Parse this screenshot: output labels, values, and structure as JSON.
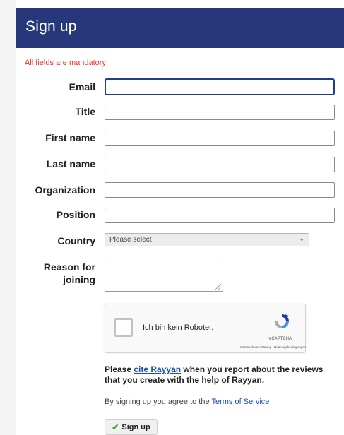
{
  "header": {
    "title": "Sign up"
  },
  "form": {
    "mandatory_note": "All fields are mandatory",
    "fields": {
      "email": {
        "label": "Email",
        "value": ""
      },
      "title": {
        "label": "Title",
        "value": ""
      },
      "first_name": {
        "label": "First name",
        "value": ""
      },
      "last_name": {
        "label": "Last name",
        "value": ""
      },
      "organization": {
        "label": "Organization",
        "value": ""
      },
      "position": {
        "label": "Position",
        "value": ""
      },
      "country": {
        "label": "Country",
        "selected": "Please select"
      },
      "reason": {
        "label_line1": "Reason for",
        "label_line2": "joining",
        "value": ""
      }
    },
    "captcha": {
      "checkbox_label": "Ich bin kein Roboter.",
      "brand": "reCAPTCHA",
      "links": "Datenschutzerklärung - Nutzungsbedingungen"
    },
    "note": {
      "prefix": "Please ",
      "link": "cite Rayyan",
      "suffix": " when you report about the reviews that you create with the help of Rayyan."
    },
    "agree": {
      "prefix": "By signing up you agree to the ",
      "link": "Terms of Service"
    },
    "submit_label": "Sign up"
  },
  "colors": {
    "header_bg": "#26387a",
    "mandatory_text": "#e8312f",
    "link": "#1a4fb0",
    "check": "#3aa339"
  },
  "icons": [
    "recaptcha-logo-icon",
    "check-icon",
    "chevron-down-icon",
    "resize-grip-icon"
  ]
}
